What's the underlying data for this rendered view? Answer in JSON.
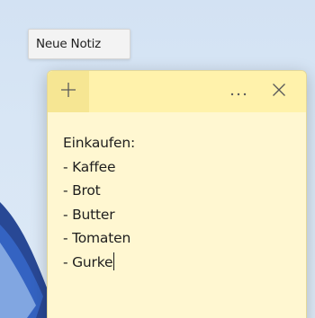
{
  "tooltip": {
    "label": "Neue Notiz"
  },
  "note": {
    "header": {
      "add_icon": "plus-icon",
      "more_icon": "more-options-icon",
      "close_icon": "close-icon"
    },
    "lines": [
      "Einkaufen:",
      "- Kaffee",
      "- Brot",
      "- Butter",
      "- Tomaten",
      "- Gurke"
    ]
  },
  "colors": {
    "note_background": "#fff7d1",
    "note_header": "#fff2ab",
    "add_button_background": "#f6e693"
  }
}
